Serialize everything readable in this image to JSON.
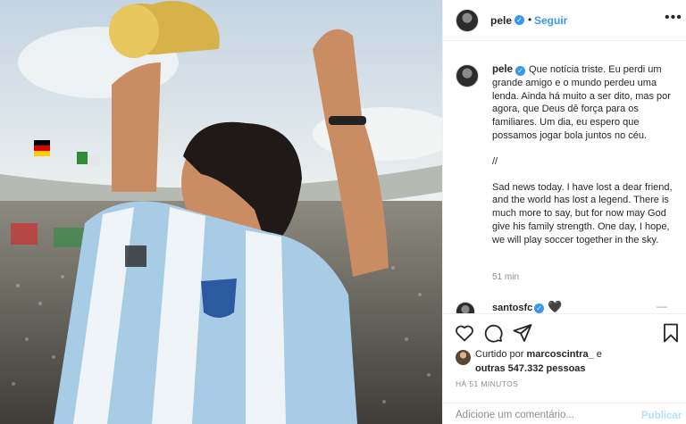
{
  "colors": {
    "accent": "#3897f0",
    "text": "#262626",
    "muted": "#8e8e8e",
    "publish_disabled": "#b2dffc"
  },
  "post": {
    "image_description_icon": "photo"
  },
  "header": {
    "username": "pele",
    "verified_icon": "verified-badge-icon",
    "separator": "•",
    "follow_label": "Seguir",
    "more_icon": "more-options-icon",
    "more_glyph": "•••"
  },
  "caption": {
    "username": "pele",
    "paragraph_pt": "Que notícia triste. Eu perdi um grande amigo e o mundo perdeu uma lenda. Ainda há muito a ser dito, mas por agora, que Deus dê força para os familiares. Um dia, eu espero que possamos jogar bola juntos no céu.",
    "separator": "//",
    "paragraph_en": "Sad news today. I have lost a dear friend, and the world has lost a legend. There is much more to say, but for now may God give his family strength. One day, I hope, we will play soccer together in the sky.",
    "time": "51 min"
  },
  "comment": {
    "username": "santosfc",
    "emoji": "🖤",
    "reply_glyph": "—"
  },
  "actions": {
    "like_icon": "heart-icon",
    "comment_icon": "comment-icon",
    "share_icon": "share-icon",
    "save_icon": "bookmark-icon"
  },
  "likes": {
    "prefix": "Curtido por ",
    "user": "marcoscintra_",
    "conjunction": " e",
    "others": "outras 547.332 pessoas"
  },
  "time_ago": "HÁ 51 MINUTOS",
  "comment_box": {
    "placeholder": "Adicione um comentário...",
    "publish_label": "Publicar"
  }
}
